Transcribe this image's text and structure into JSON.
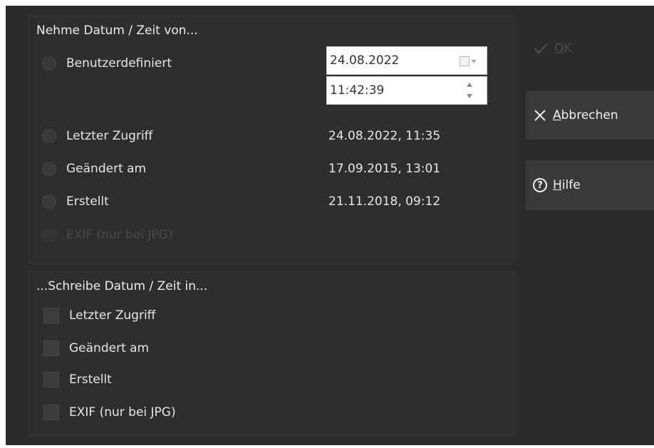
{
  "source": {
    "title": "Nehme Datum / Zeit von...",
    "options": [
      {
        "label": "Benutzerdefiniert",
        "value": ""
      },
      {
        "label": "Letzter Zugriff",
        "value": "24.08.2022, 11:35"
      },
      {
        "label": "Geändert am",
        "value": "17.09.2015, 13:01"
      },
      {
        "label": "Erstellt",
        "value": "21.11.2018, 09:12"
      },
      {
        "label": "EXIF (nur bei JPG)",
        "value": ""
      }
    ],
    "date_value": "24.08.2022",
    "time_value": "11:42:39"
  },
  "target": {
    "title": "...Schreibe Datum / Zeit in...",
    "options": [
      {
        "label": "Letzter Zugriff"
      },
      {
        "label": "Geändert am"
      },
      {
        "label": "Erstellt"
      },
      {
        "label": "EXIF (nur bei JPG)"
      }
    ]
  },
  "buttons": {
    "ok_mnemonic": "O",
    "ok_rest": "K",
    "cancel_mnemonic": "A",
    "cancel_rest": "bbrechen",
    "help_mnemonic": "H",
    "help_rest": "ilfe"
  },
  "icons": {
    "ok": "check-icon",
    "cancel": "x-icon",
    "help": "question-circle-icon",
    "calendar": "calendar-icon",
    "spinner": "spinner-icon"
  },
  "colors": {
    "dialog_bg": "#2b2b2b",
    "button_bg": "#3a3a3a",
    "text": "#e6e6e6",
    "disabled_text": "#4a4a4a"
  }
}
